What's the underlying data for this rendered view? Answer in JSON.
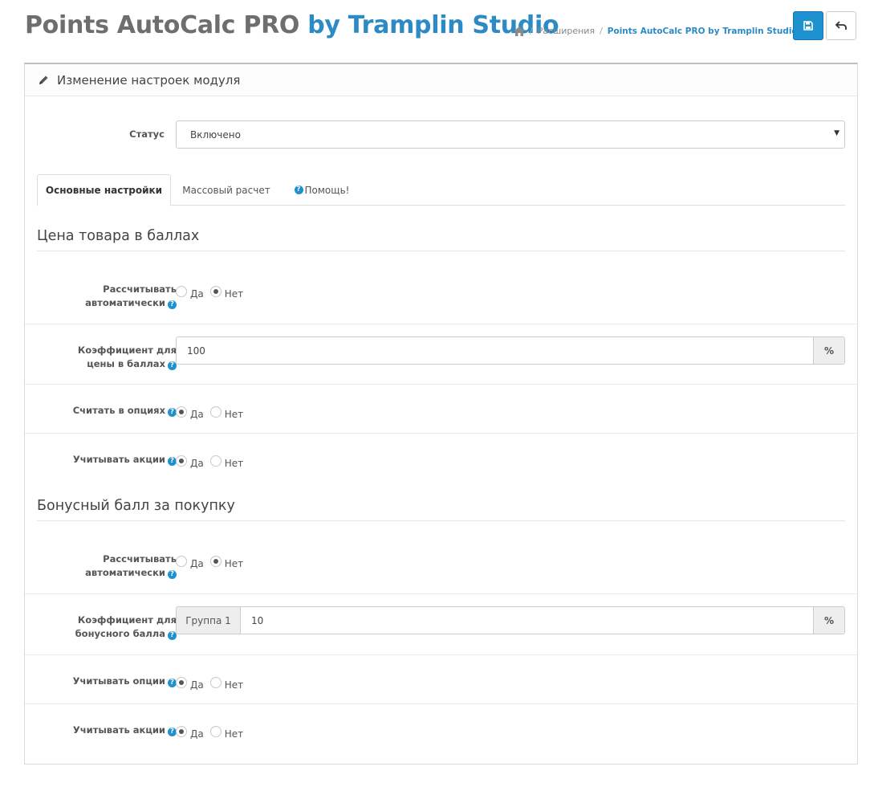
{
  "header": {
    "title_main": "Points AutoCalc PRO ",
    "title_accent": "by Tramplin Studio",
    "breadcrumb": [
      "Расширения",
      "Points AutoCalc PRO by Tramplin Studio"
    ],
    "save_icon": "floppy-disk-icon",
    "back_icon": "reply-arrow-icon"
  },
  "panel": {
    "heading": "Изменение настроек модуля",
    "heading_icon": "pencil-icon",
    "status": {
      "label": "Статус",
      "value": "Включено"
    },
    "tabs": [
      "Основные настройки",
      "Массовый расчет",
      "Помощь!"
    ],
    "active_tab": 0
  },
  "section1": {
    "title": "Цена товара в баллах",
    "auto_calc": {
      "label_line1": "Рассчитывать",
      "label_line2": "автоматически",
      "selected": "Нет"
    },
    "coef": {
      "label_line1": "Коэффициент для",
      "label_line2": "цены в баллах",
      "value": "100",
      "suffix": "%"
    },
    "options": {
      "label": "Считать в опциях",
      "selected": "Да"
    },
    "promo": {
      "label": "Учитывать акции",
      "selected": "Да"
    }
  },
  "section2": {
    "title": "Бонусный балл за покупку",
    "auto_calc": {
      "label_line1": "Рассчитывать",
      "label_line2": "автоматически",
      "selected": "Нет"
    },
    "coef": {
      "label_line1": "Коэффициент для",
      "label_line2": "бонусного балла",
      "group": "Группа 1",
      "value": "10",
      "suffix": "%"
    },
    "options": {
      "label": "Учитывать опции",
      "selected": "Да"
    },
    "promo": {
      "label": "Учитывать акции",
      "selected": "Да"
    }
  },
  "radio_labels": {
    "yes": "Да",
    "no": "Нет"
  },
  "colors": {
    "accent": "#2c8bc5",
    "primary_button": "#1e91cf",
    "title_gray": "#6e6e6e"
  }
}
